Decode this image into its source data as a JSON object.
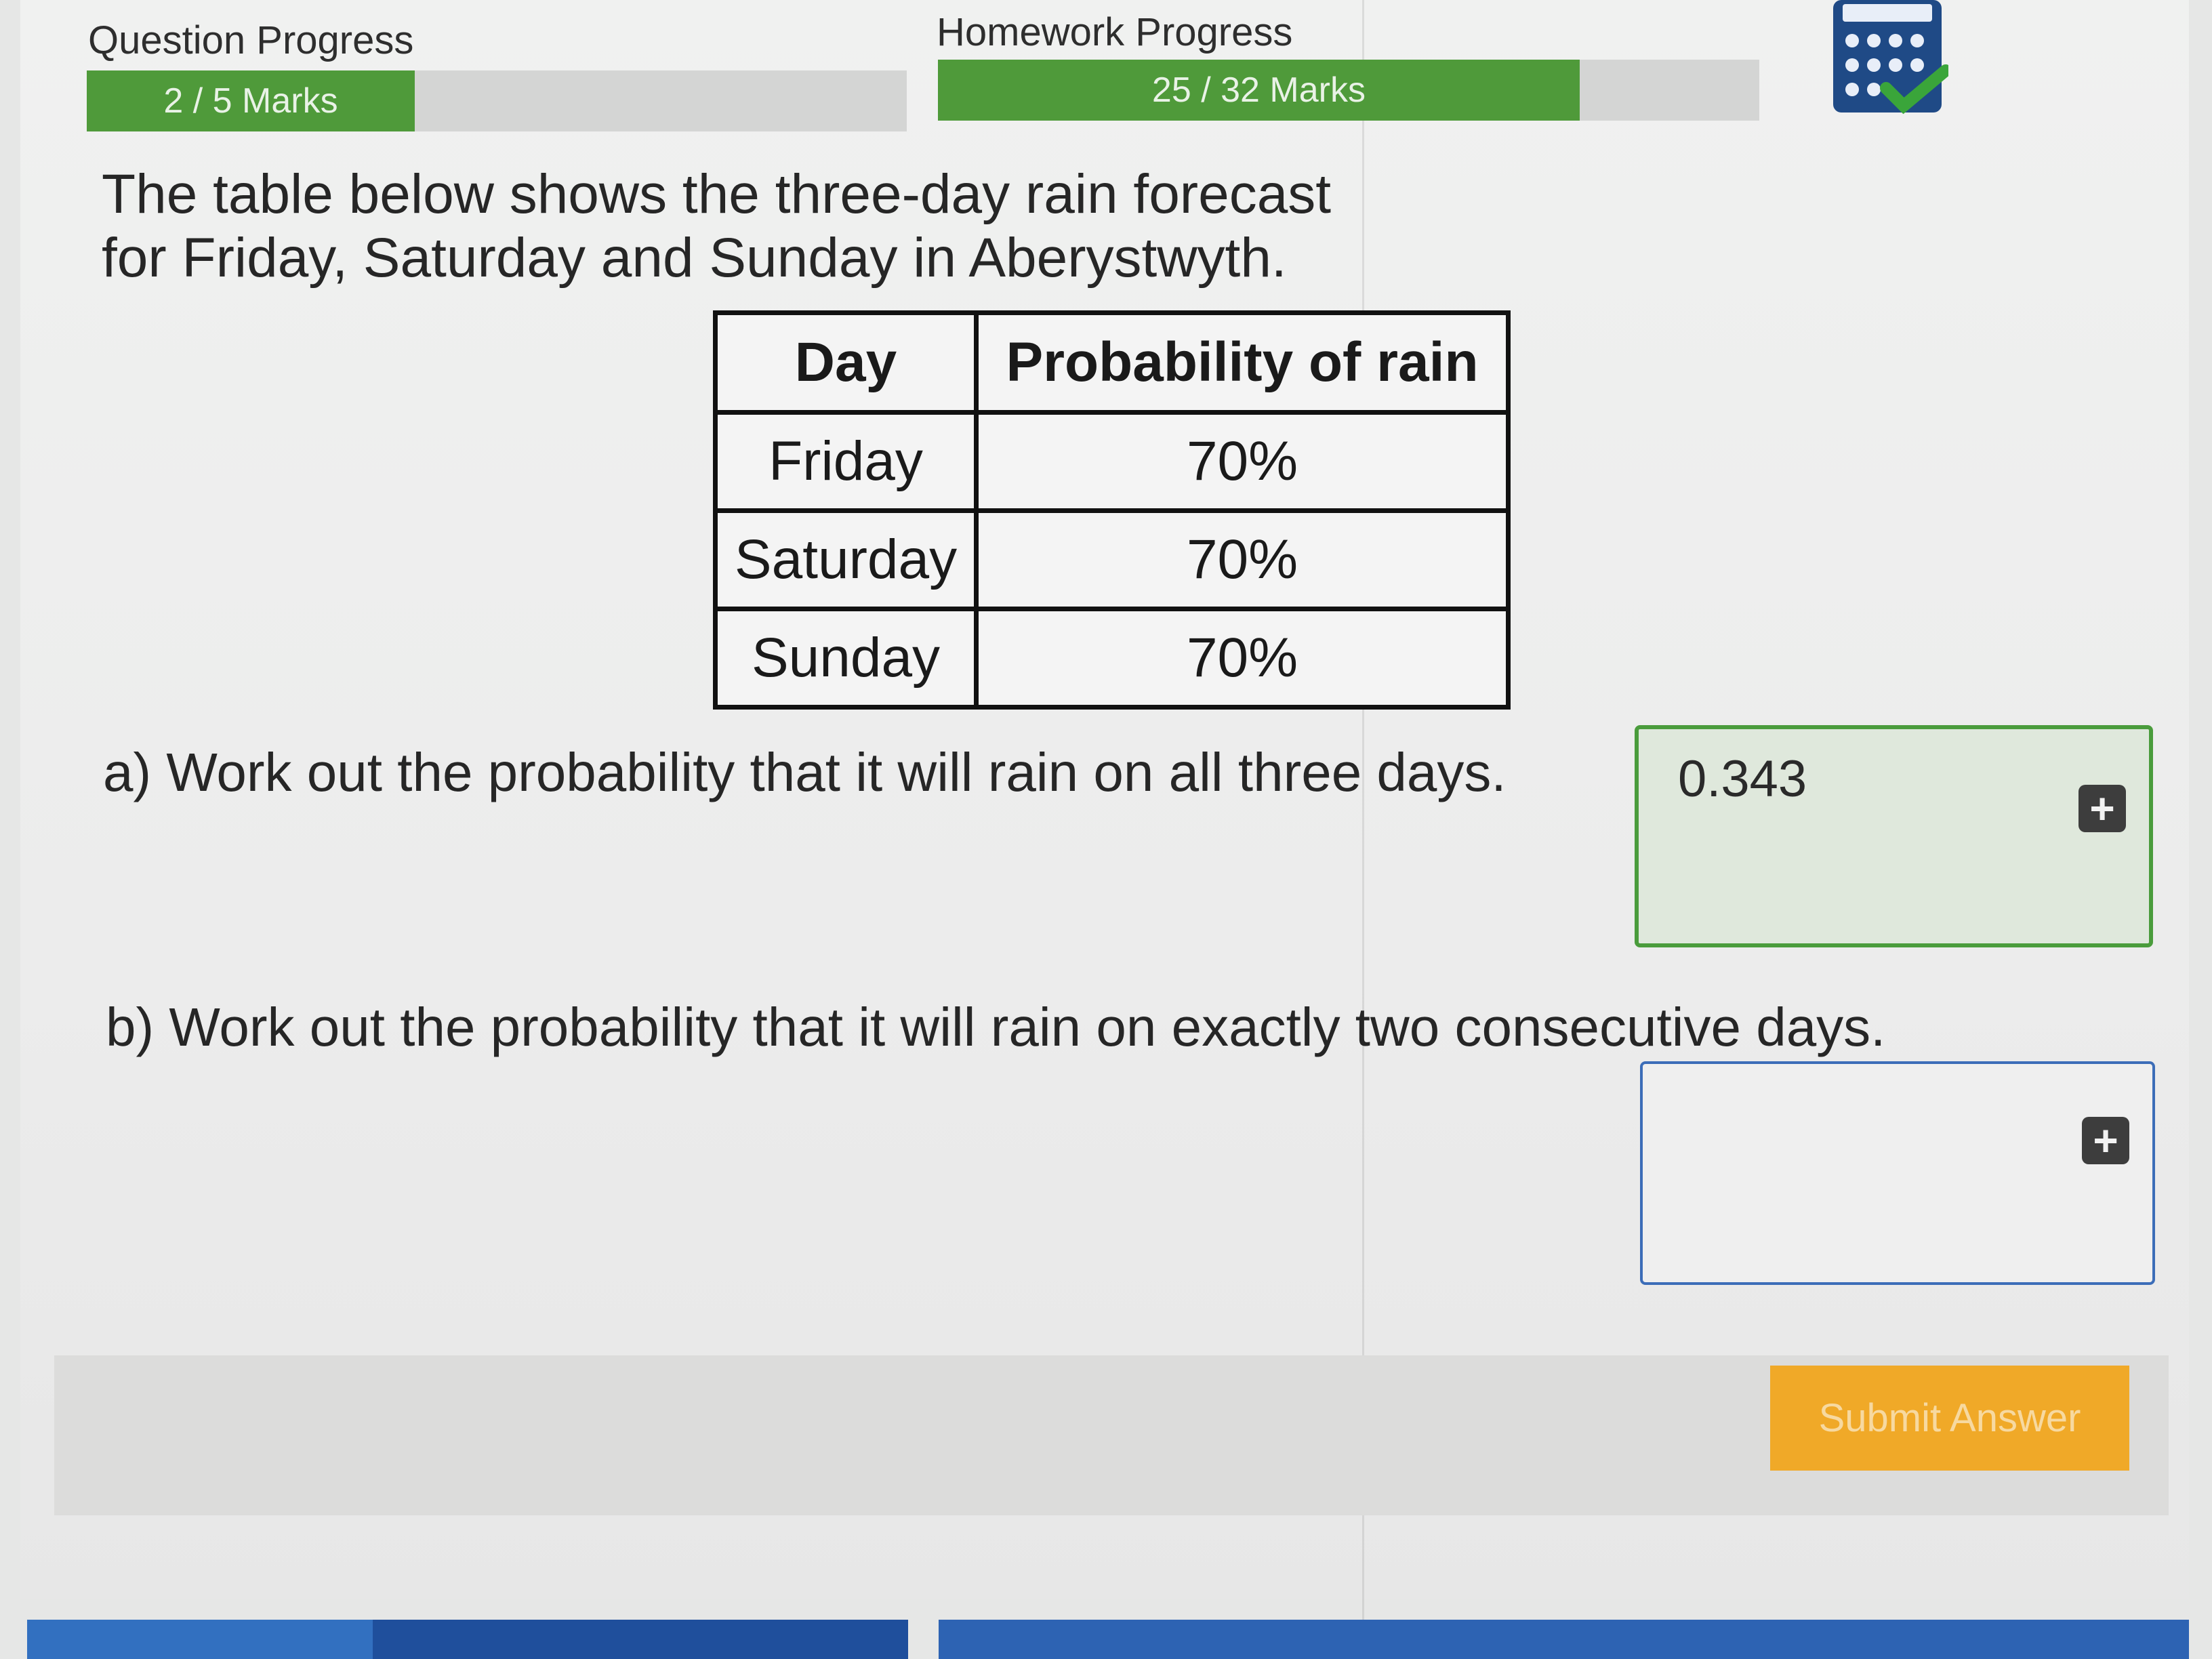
{
  "question_progress": {
    "label": "Question Progress",
    "marks_text": "2 / 5 Marks",
    "earned": 2,
    "total": 5
  },
  "homework_progress": {
    "label": "Homework Progress",
    "marks_text": "25 / 32 Marks",
    "earned": 25,
    "total": 32
  },
  "toolbar": {
    "calculator_icon": "calculator-allowed-icon"
  },
  "question": {
    "intro_line1": "The table below shows the three-day rain forecast",
    "intro_line2": "for Friday, Saturday and Sunday in Aberystwyth.",
    "table": {
      "headers": [
        "Day",
        "Probability of rain"
      ],
      "rows": [
        [
          "Friday",
          "70%"
        ],
        [
          "Saturday",
          "70%"
        ],
        [
          "Sunday",
          "70%"
        ]
      ]
    },
    "part_a": {
      "text": "a) Work out the probability that it will rain on all three days.",
      "answer": "0.343"
    },
    "part_b": {
      "text": "b) Work out the probability that it will rain on exactly two consecutive days.",
      "answer": ""
    }
  },
  "actions": {
    "submit_label": "Submit Answer"
  },
  "colors": {
    "progress_green": "#4f9a3a",
    "submit_orange": "#f0a928",
    "nav_blue": "#2d63b3"
  }
}
